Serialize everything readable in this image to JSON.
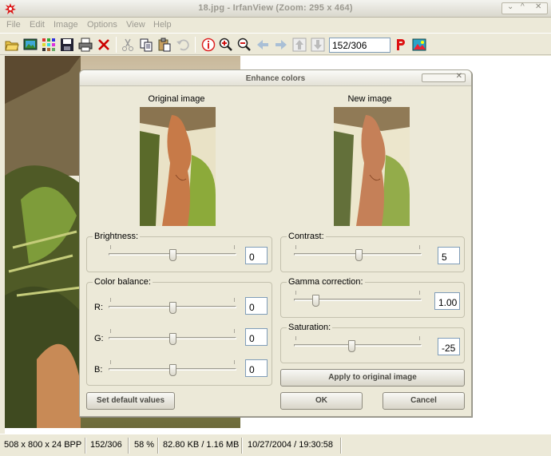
{
  "window": {
    "title": "18.jpg - IrfanView (Zoom: 295 x 464)",
    "controls": [
      "⌄",
      "^",
      "✕"
    ]
  },
  "menu": [
    "File",
    "Edit",
    "Image",
    "Options",
    "View",
    "Help"
  ],
  "toolbar": {
    "page_value": "152/306",
    "icons": [
      "open-folder",
      "slideshow",
      "thumbnails",
      "save",
      "print",
      "delete",
      "cut",
      "copy",
      "paste",
      "undo",
      "info",
      "zoom-in",
      "zoom-out",
      "prev-arrow",
      "next-arrow",
      "first-page",
      "last-page",
      "paint",
      "edit-image"
    ]
  },
  "status": {
    "dimensions": "508 x 800 x 24 BPP",
    "index": "152/306",
    "zoom": "58 %",
    "size": "82.80 KB / 1.16 MB",
    "datetime": "10/27/2004 / 19:30:58"
  },
  "dialog": {
    "title": "Enhance colors",
    "original_label": "Original image",
    "new_label": "New image",
    "brightness": {
      "label": "Brightness:",
      "value": "0",
      "level": 0.5
    },
    "color_balance": {
      "label": "Color balance:",
      "r": {
        "label": "R:",
        "value": "0",
        "level": 0.5
      },
      "g": {
        "label": "G:",
        "value": "0",
        "level": 0.5
      },
      "b": {
        "label": "B:",
        "value": "0",
        "level": 0.5
      }
    },
    "contrast": {
      "label": "Contrast:",
      "value": "5",
      "level": 0.51
    },
    "gamma": {
      "label": "Gamma correction:",
      "value": "1.00",
      "level": 0.15
    },
    "saturation": {
      "label": "Saturation:",
      "value": "-25",
      "level": 0.45
    },
    "buttons": {
      "apply": "Apply to original image",
      "defaults": "Set default values",
      "ok": "OK",
      "cancel": "Cancel"
    }
  }
}
